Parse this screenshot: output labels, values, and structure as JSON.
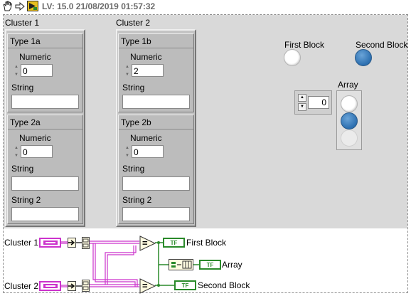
{
  "toolbar": {
    "title": "LV: 15.0 21/08/2019 01:57:32",
    "icons": [
      "hand-tool-icon",
      "arrow-tool-icon",
      "vi-icon"
    ]
  },
  "front_panel": {
    "clusters": [
      {
        "label": "Cluster 1",
        "subclusters": [
          {
            "label": "Type 1a",
            "numeric_label": "Numeric",
            "numeric_value": "0",
            "string_label": "String",
            "string_value": ""
          },
          {
            "label": "Type 2a",
            "numeric_label": "Numeric",
            "numeric_value": "0",
            "string_label": "String",
            "string_value": "",
            "string2_label": "String 2",
            "string2_value": ""
          }
        ]
      },
      {
        "label": "Cluster 2",
        "subclusters": [
          {
            "label": "Type 1b",
            "numeric_label": "Numeric",
            "numeric_value": "2",
            "string_label": "String",
            "string_value": ""
          },
          {
            "label": "Type 2b",
            "numeric_label": "Numeric",
            "numeric_value": "0",
            "string_label": "String",
            "string_value": "",
            "string2_label": "String 2",
            "string2_value": ""
          }
        ]
      }
    ],
    "first_block": {
      "label": "First Block",
      "state": "off"
    },
    "second_block": {
      "label": "Second Block",
      "state": "on"
    },
    "array": {
      "label": "Array",
      "index": "0",
      "elements": [
        "off",
        "on",
        "dim"
      ]
    }
  },
  "block_diagram": {
    "cluster1_label": "Cluster 1",
    "cluster2_label": "Cluster 2",
    "first_block_label": "First Block",
    "array_label": "Array",
    "second_block_label": "Second Block",
    "bool_terminal_text": "TF",
    "equals_symbol": "="
  },
  "colors": {
    "panel_bg": "#d9d9d9",
    "cluster_wire": "#cc33cc",
    "bool_wire": "#2a8a2a",
    "led_on": "#2c6fb0"
  }
}
